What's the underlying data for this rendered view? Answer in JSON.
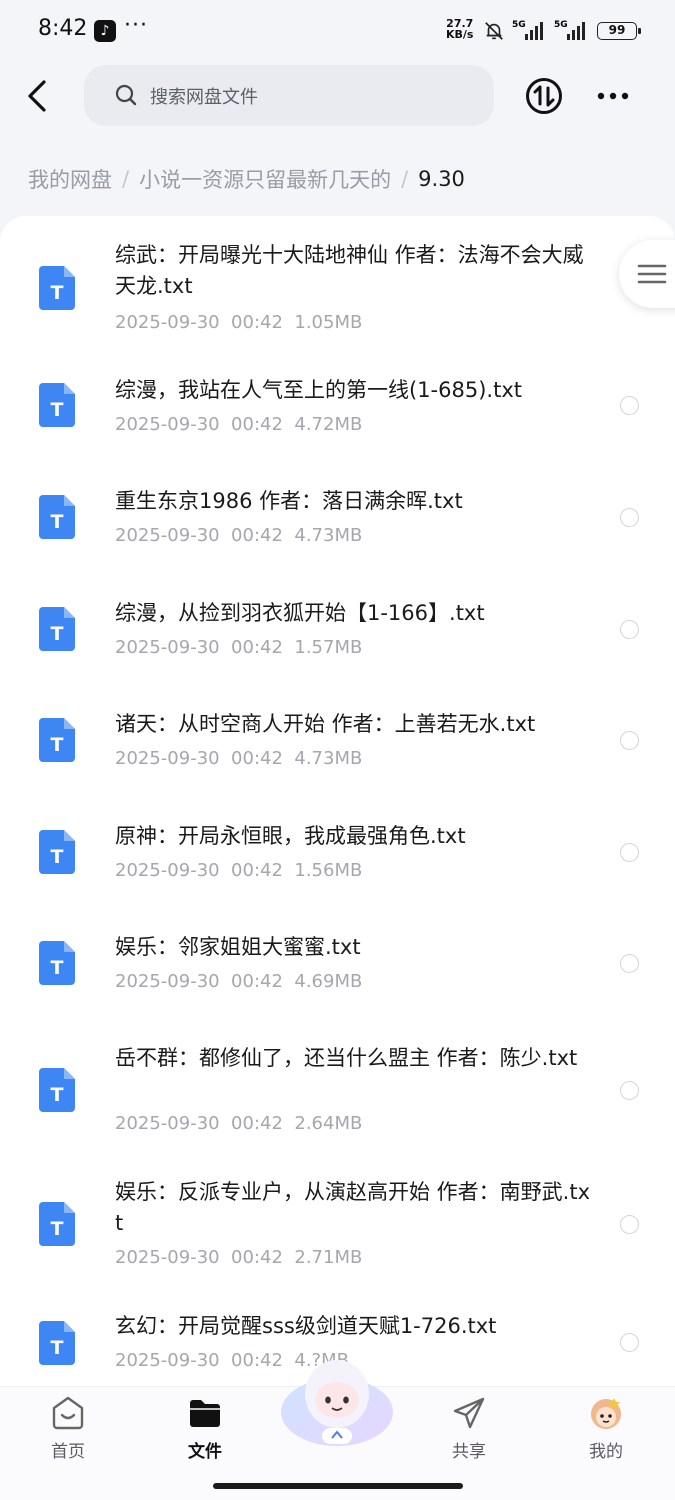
{
  "status_bar": {
    "time": "8:42",
    "dots": "···",
    "net_speed_value": "27.7",
    "net_speed_unit": "KB/s",
    "signal_1": "5G",
    "signal_2": "5G",
    "battery": "99"
  },
  "header": {
    "search_placeholder": "搜索网盘文件"
  },
  "breadcrumb": {
    "root": "我的网盘",
    "folder": "小说一资源只留最新几天的",
    "current": "9.30",
    "separator": "/"
  },
  "files": [
    {
      "name": "综武：开局曝光十大陆地神仙 作者：法海不会大威天龙.txt",
      "meta": "2025-09-30  00:42  1.05MB"
    },
    {
      "name": "综漫，我站在人气至上的第一线(1-685).txt",
      "meta": "2025-09-30  00:42  4.72MB"
    },
    {
      "name": "重生东京1986 作者：落日满余晖.txt",
      "meta": "2025-09-30  00:42  4.73MB"
    },
    {
      "name": "综漫，从捡到羽衣狐开始【1-166】.txt",
      "meta": "2025-09-30  00:42  1.57MB"
    },
    {
      "name": "诸天：从时空商人开始 作者：上善若无水.txt",
      "meta": "2025-09-30  00:42  4.73MB"
    },
    {
      "name": "原神：开局永恒眼，我成最强角色.txt",
      "meta": "2025-09-30  00:42  1.56MB"
    },
    {
      "name": "娱乐：邻家姐姐大蜜蜜.txt",
      "meta": "2025-09-30  00:42  4.69MB"
    },
    {
      "name": "岳不群：都修仙了，还当什么盟主 作者：陈少.txt",
      "meta": "2025-09-30  00:42  2.64MB"
    },
    {
      "name": "娱乐：反派专业户，从演赵高开始 作者：南野武.txt",
      "meta": "2025-09-30  00:42  2.71MB"
    },
    {
      "name": "玄幻：开局觉醒sss级剑道天赋1-726.txt",
      "meta": "2025-09-30  00:42  4.?MB"
    }
  ],
  "file_icon_letter": "T",
  "bottom_nav": {
    "home": "首页",
    "files": "文件",
    "share": "共享",
    "mine": "我的"
  },
  "colors": {
    "accent": "#3b82f6",
    "file_icon": "#3d86f4"
  }
}
